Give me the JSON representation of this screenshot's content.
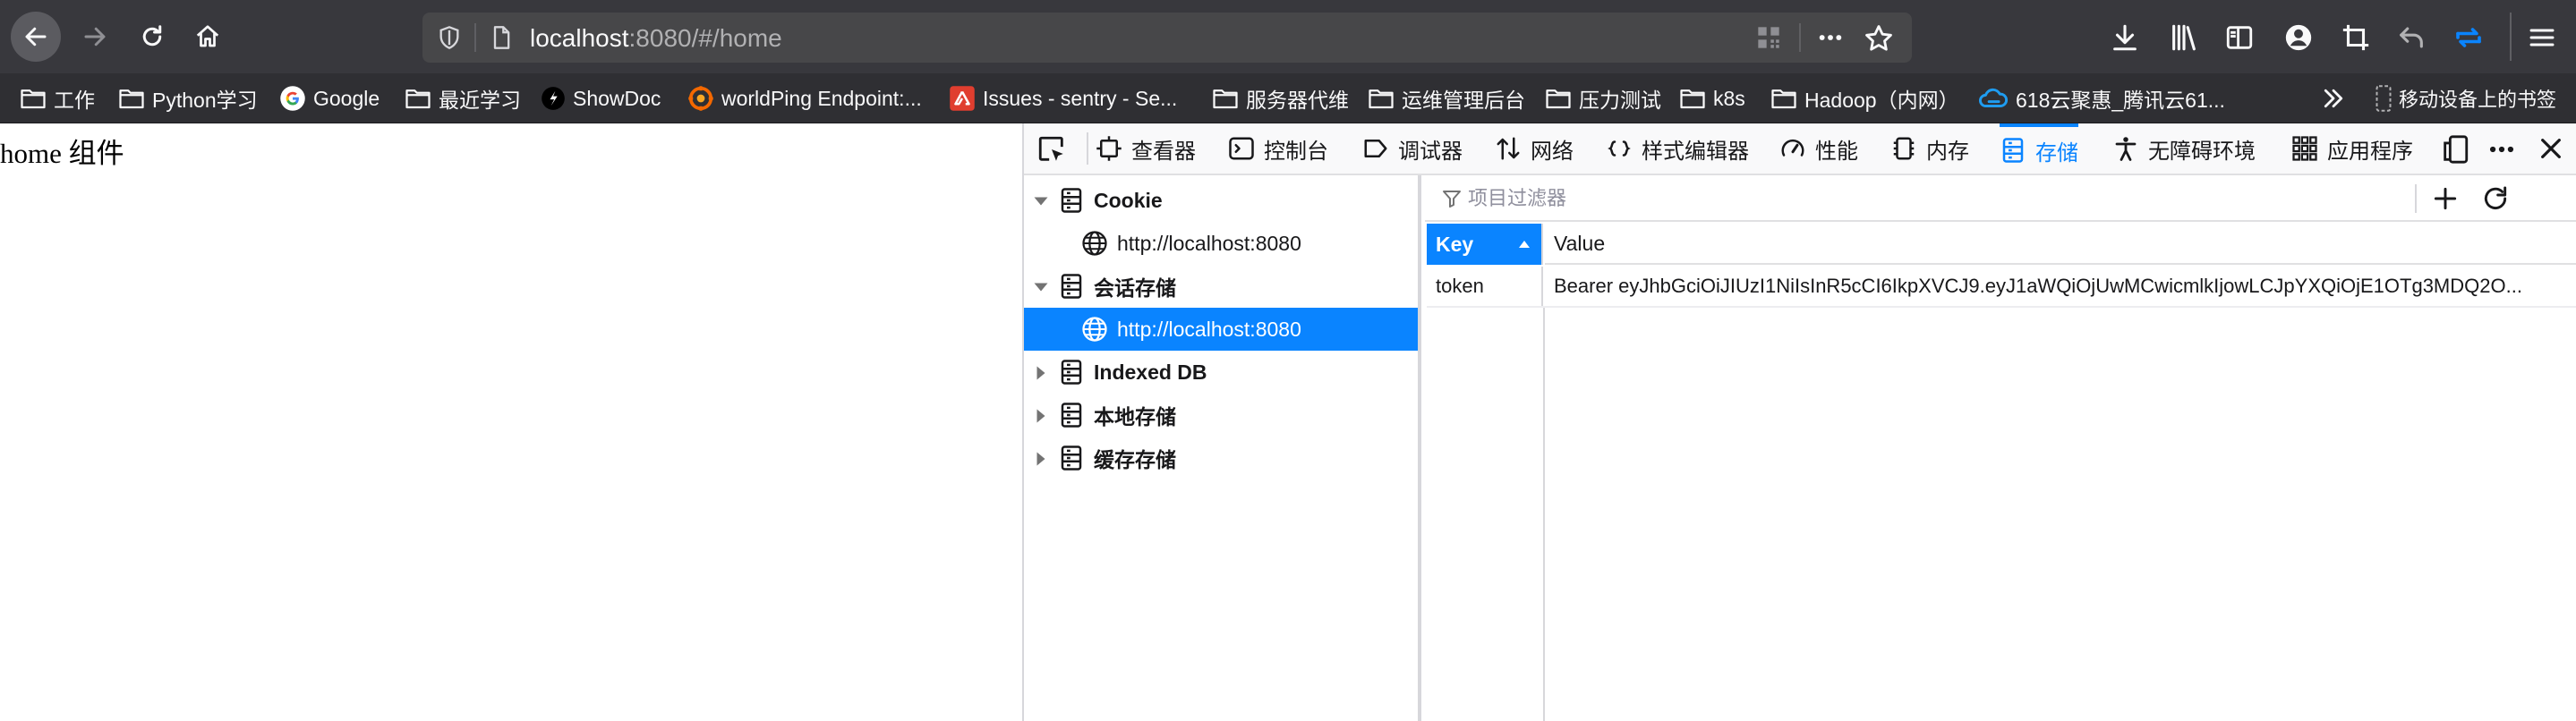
{
  "browser": {
    "url_host": "localhost",
    "url_rest": ":8080/#/home"
  },
  "bookmarks": [
    {
      "label": "工作",
      "icon": "folder-icon"
    },
    {
      "label": "Python学习",
      "icon": "folder-icon"
    },
    {
      "label": "Google",
      "icon": "google-icon"
    },
    {
      "label": "最近学习",
      "icon": "folder-icon"
    },
    {
      "label": "ShowDoc",
      "icon": "showdoc-icon"
    },
    {
      "label": "worldPing Endpoint:...",
      "icon": "grafana-icon"
    },
    {
      "label": "Issues - sentry - Se...",
      "icon": "sentry-icon"
    },
    {
      "label": "服务器代维",
      "icon": "folder-icon"
    },
    {
      "label": "运维管理后台",
      "icon": "folder-icon"
    },
    {
      "label": "压力测试",
      "icon": "folder-icon"
    },
    {
      "label": "k8s",
      "icon": "folder-icon"
    },
    {
      "label": "Hadoop（内网）",
      "icon": "folder-icon"
    },
    {
      "label": "618云聚惠_腾讯云61...",
      "icon": "tencent-cloud-icon"
    },
    {
      "label": "移动设备上的书签",
      "icon": "mobile-bookmarks-icon"
    }
  ],
  "page": {
    "text": "home 组件"
  },
  "devtools": {
    "tabs": [
      {
        "label": "查看器",
        "icon": "inspector-icon"
      },
      {
        "label": "控制台",
        "icon": "console-icon"
      },
      {
        "label": "调试器",
        "icon": "debugger-icon"
      },
      {
        "label": "网络",
        "icon": "network-icon"
      },
      {
        "label": "样式编辑器",
        "icon": "style-editor-icon"
      },
      {
        "label": "性能",
        "icon": "performance-icon"
      },
      {
        "label": "内存",
        "icon": "memory-icon"
      },
      {
        "label": "存储",
        "icon": "storage-icon",
        "active": true
      },
      {
        "label": "无障碍环境",
        "icon": "accessibility-icon"
      },
      {
        "label": "应用程序",
        "icon": "application-icon"
      }
    ],
    "tree": [
      {
        "label": "Cookie",
        "type": "category",
        "expanded": true
      },
      {
        "label": "http://localhost:8080",
        "type": "host"
      },
      {
        "label": "会话存储",
        "type": "category",
        "expanded": true
      },
      {
        "label": "http://localhost:8080",
        "type": "host",
        "selected": true
      },
      {
        "label": "Indexed DB",
        "type": "category",
        "expanded": false
      },
      {
        "label": "本地存储",
        "type": "category",
        "expanded": false
      },
      {
        "label": "缓存存储",
        "type": "category",
        "expanded": false
      }
    ],
    "filter_placeholder": "项目过滤器",
    "table": {
      "headers": {
        "key": "Key",
        "value": "Value"
      },
      "rows": [
        {
          "key": "token",
          "value": "Bearer eyJhbGciOiJIUzI1NiIsInR5cCI6IkpXVCJ9.eyJ1aWQiOjUwMCwicmlkIjowLCJpYXQiOjE1OTg3MDQ2O..."
        }
      ]
    }
  },
  "colors": {
    "toolbar_bg": "#38383d",
    "bookmarks_bg": "#2f2f33",
    "accent": "#0a84ff"
  }
}
